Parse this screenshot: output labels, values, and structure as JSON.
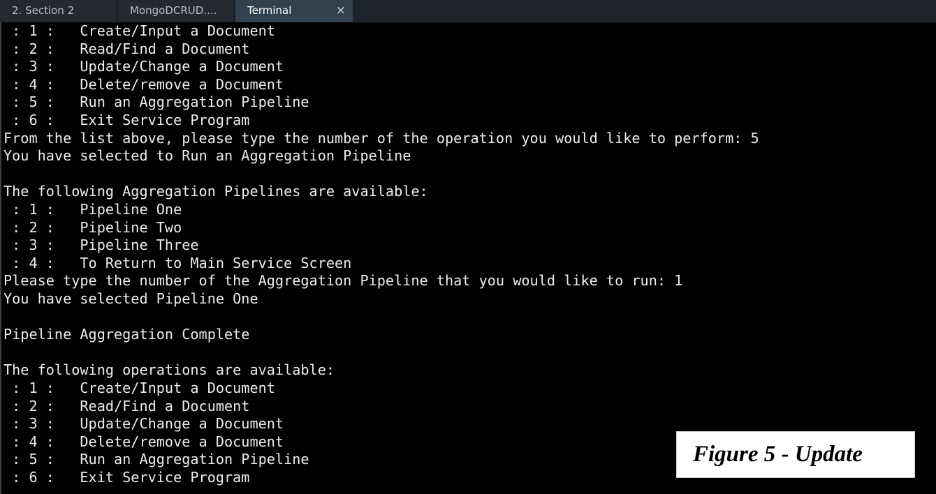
{
  "tabs": [
    {
      "label": "2. Section 2",
      "active": false
    },
    {
      "label": "MongoDCRUD....",
      "active": false
    },
    {
      "label": "Terminal",
      "active": true,
      "close_glyph": "×"
    }
  ],
  "terminal": {
    "lines": [
      " : 1 :   Create/Input a Document",
      " : 2 :   Read/Find a Document",
      " : 3 :   Update/Change a Document",
      " : 4 :   Delete/remove a Document",
      " : 5 :   Run an Aggregation Pipeline",
      " : 6 :   Exit Service Program",
      "From the list above, please type the number of the operation you would like to perform: 5",
      "You have selected to Run an Aggregation Pipeline",
      "",
      "The following Aggregation Pipelines are available:",
      " : 1 :   Pipeline One",
      " : 2 :   Pipeline Two",
      " : 3 :   Pipeline Three",
      " : 4 :   To Return to Main Service Screen",
      "Please type the number of the Aggregation Pipeline that you would like to run: 1",
      "You have selected Pipeline One",
      "",
      "Pipeline Aggregation Complete",
      "",
      "The following operations are available:",
      " : 1 :   Create/Input a Document",
      " : 2 :   Read/Find a Document",
      " : 3 :   Update/Change a Document",
      " : 4 :   Delete/remove a Document",
      " : 5 :   Run an Aggregation Pipeline",
      " : 6 :   Exit Service Program"
    ]
  },
  "figure_label": "Figure 5 - Update",
  "colors": {
    "terminal_background": "#000000",
    "terminal_text": "#ececec",
    "tabbar_background": "#1e2329",
    "active_tab_background": "#33404d"
  }
}
